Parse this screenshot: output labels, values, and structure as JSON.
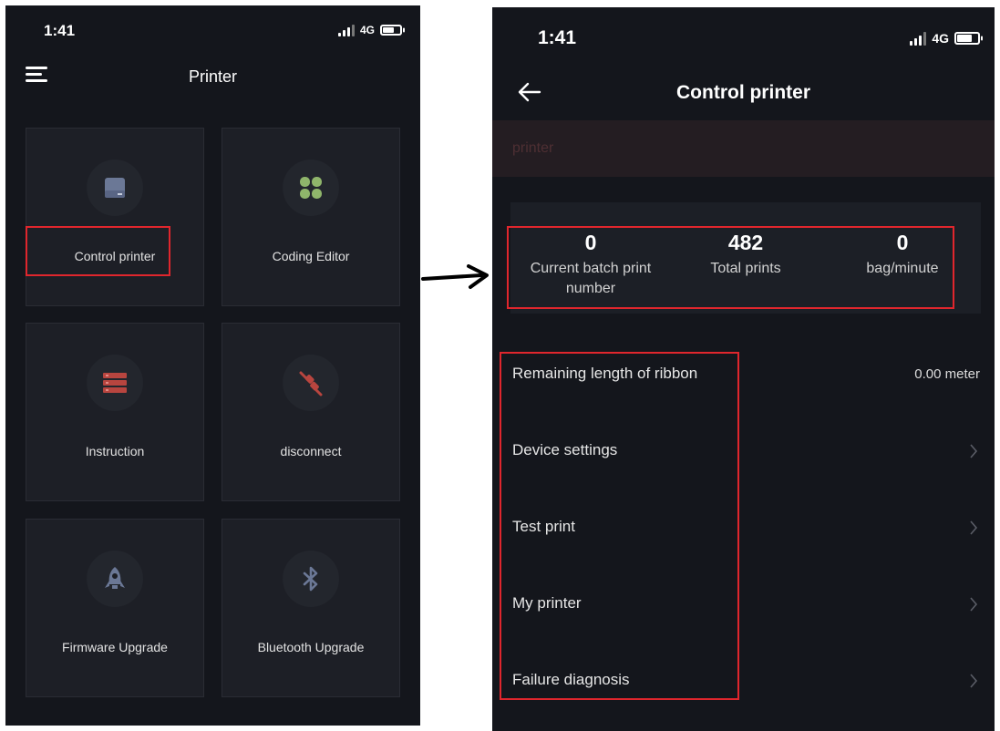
{
  "left_screen": {
    "status": {
      "time": "1:41",
      "network": "4G"
    },
    "title": "Printer",
    "tiles": [
      {
        "label": "Control printer",
        "icon": "printer-icon",
        "color": "#6b7896"
      },
      {
        "label": "Coding Editor",
        "icon": "grid-icon",
        "color": "#8fb56b"
      },
      {
        "label": "Instruction",
        "icon": "list-icon",
        "color": "#b8453f"
      },
      {
        "label": "disconnect",
        "icon": "plug-icon",
        "color": "#b8453f"
      },
      {
        "label": "Firmware Upgrade",
        "icon": "rocket-icon",
        "color": "#6b7896"
      },
      {
        "label": "Bluetooth Upgrade",
        "icon": "bluetooth-icon",
        "color": "#6b7896"
      }
    ]
  },
  "right_screen": {
    "status": {
      "time": "1:41",
      "network": "4G"
    },
    "title": "Control printer",
    "printer_name": "printer",
    "stats": [
      {
        "value": "0",
        "label": "Current batch print number"
      },
      {
        "value": "482",
        "label": "Total prints"
      },
      {
        "value": "0",
        "label": "bag/minute"
      }
    ],
    "menu": [
      {
        "label": "Remaining length of ribbon",
        "value": "0.00 meter"
      },
      {
        "label": "Device settings"
      },
      {
        "label": "Test print"
      },
      {
        "label": "My printer"
      },
      {
        "label": "Failure diagnosis"
      }
    ]
  },
  "annotation_color": "#e0262d"
}
